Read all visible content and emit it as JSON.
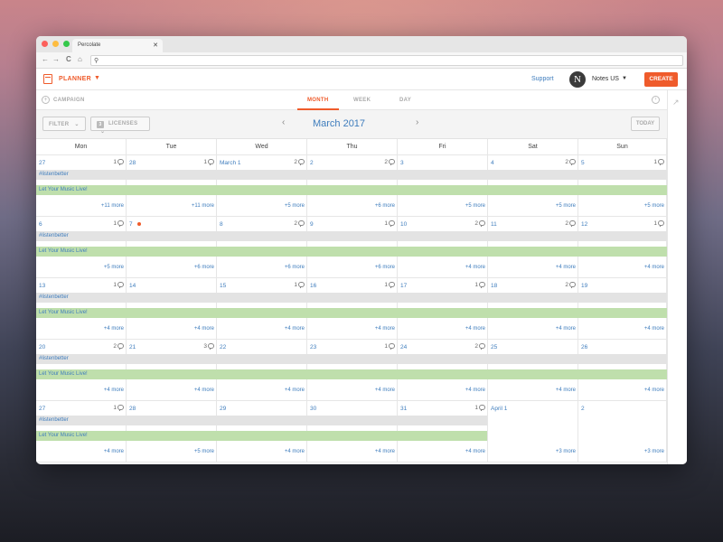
{
  "browser": {
    "tab_title": "Percolate",
    "close_glyph": "✕",
    "back_glyph": "←",
    "forward_glyph": "→",
    "reload_glyph": "C",
    "home_glyph": "⌂",
    "search_glyph": "⚲"
  },
  "header": {
    "app_label": "PLANNER",
    "caret": "▼",
    "support": "Support",
    "avatar_letter": "N",
    "org": "Notes US",
    "org_caret": "▼",
    "create": "CREATE"
  },
  "subheader": {
    "campaign": "CAMPAIGN",
    "campaign_icon": "+",
    "tabs": [
      {
        "label": "MONTH",
        "active": true
      },
      {
        "label": "WEEK",
        "active": false
      },
      {
        "label": "DAY",
        "active": false
      }
    ],
    "next_glyph": "›",
    "trend_glyph": "↗"
  },
  "toolbar": {
    "filter": "FILTER",
    "filter_caret": "⌄",
    "licenses_count": "3",
    "licenses": "LICENSES",
    "licenses_caret": "⌄",
    "month_title": "March 2017",
    "prev": "‹",
    "next": "›",
    "today": "TODAY"
  },
  "calendar": {
    "days": [
      "Mon",
      "Tue",
      "Wed",
      "Thu",
      "Fri",
      "Sat",
      "Sun"
    ],
    "weeks": [
      {
        "cells": [
          {
            "num": "27",
            "count": "1",
            "more": "+11 more"
          },
          {
            "num": "28",
            "count": "1",
            "more": "+11 more"
          },
          {
            "num": "March 1",
            "count": "2",
            "more": "+5 more"
          },
          {
            "num": "2",
            "count": "2",
            "more": "+6 more"
          },
          {
            "num": "3",
            "count": "",
            "more": "+5 more"
          },
          {
            "num": "4",
            "count": "2",
            "more": "+5 more"
          },
          {
            "num": "5",
            "count": "1",
            "more": "+5 more"
          }
        ],
        "bars": [
          "#listenbetter",
          "Let Your Music Live!"
        ]
      },
      {
        "cells": [
          {
            "num": "6",
            "count": "1",
            "more": "+5 more"
          },
          {
            "num": "7",
            "count": "",
            "more": "+6 more",
            "dot": true
          },
          {
            "num": "8",
            "count": "2",
            "more": "+6 more"
          },
          {
            "num": "9",
            "count": "1",
            "more": "+6 more"
          },
          {
            "num": "10",
            "count": "2",
            "more": "+4 more"
          },
          {
            "num": "11",
            "count": "2",
            "more": "+4 more"
          },
          {
            "num": "12",
            "count": "1",
            "more": "+4 more"
          }
        ],
        "bars": [
          "#listenbetter",
          "Let Your Music Live!"
        ]
      },
      {
        "cells": [
          {
            "num": "13",
            "count": "1",
            "more": "+4 more"
          },
          {
            "num": "14",
            "count": "",
            "more": "+4 more"
          },
          {
            "num": "15",
            "count": "1",
            "more": "+4 more"
          },
          {
            "num": "16",
            "count": "1",
            "more": "+4 more"
          },
          {
            "num": "17",
            "count": "1",
            "more": "+4 more"
          },
          {
            "num": "18",
            "count": "2",
            "more": "+4 more"
          },
          {
            "num": "19",
            "count": "",
            "more": "+4 more"
          }
        ],
        "bars": [
          "#listenbetter",
          "Let Your Music Live!"
        ]
      },
      {
        "cells": [
          {
            "num": "20",
            "count": "2",
            "more": "+4 more"
          },
          {
            "num": "21",
            "count": "3",
            "more": "+4 more"
          },
          {
            "num": "22",
            "count": "",
            "more": "+4 more"
          },
          {
            "num": "23",
            "count": "1",
            "more": "+4 more"
          },
          {
            "num": "24",
            "count": "2",
            "more": "+4 more"
          },
          {
            "num": "25",
            "count": "",
            "more": "+4 more"
          },
          {
            "num": "26",
            "count": "",
            "more": "+4 more"
          }
        ],
        "bars": [
          "#listenbetter",
          "Let Your Music Live!"
        ]
      },
      {
        "cells": [
          {
            "num": "27",
            "count": "1",
            "more": "+4 more"
          },
          {
            "num": "28",
            "count": "",
            "more": "+5 more"
          },
          {
            "num": "29",
            "count": "",
            "more": "+4 more"
          },
          {
            "num": "30",
            "count": "",
            "more": "+4 more"
          },
          {
            "num": "31",
            "count": "1",
            "more": "+4 more"
          },
          {
            "num": "April 1",
            "count": "",
            "more": "+3 more"
          },
          {
            "num": "2",
            "count": "",
            "more": "+3 more"
          }
        ],
        "bars": [
          "#listenbetter",
          "Let Your Music Live!"
        ],
        "bar_span_days": 5
      }
    ]
  },
  "colors": {
    "accent": "#ef5b2b",
    "link": "#3f7dbd",
    "bar_grey": "#e3e3e3",
    "bar_green": "#bfdfac"
  }
}
